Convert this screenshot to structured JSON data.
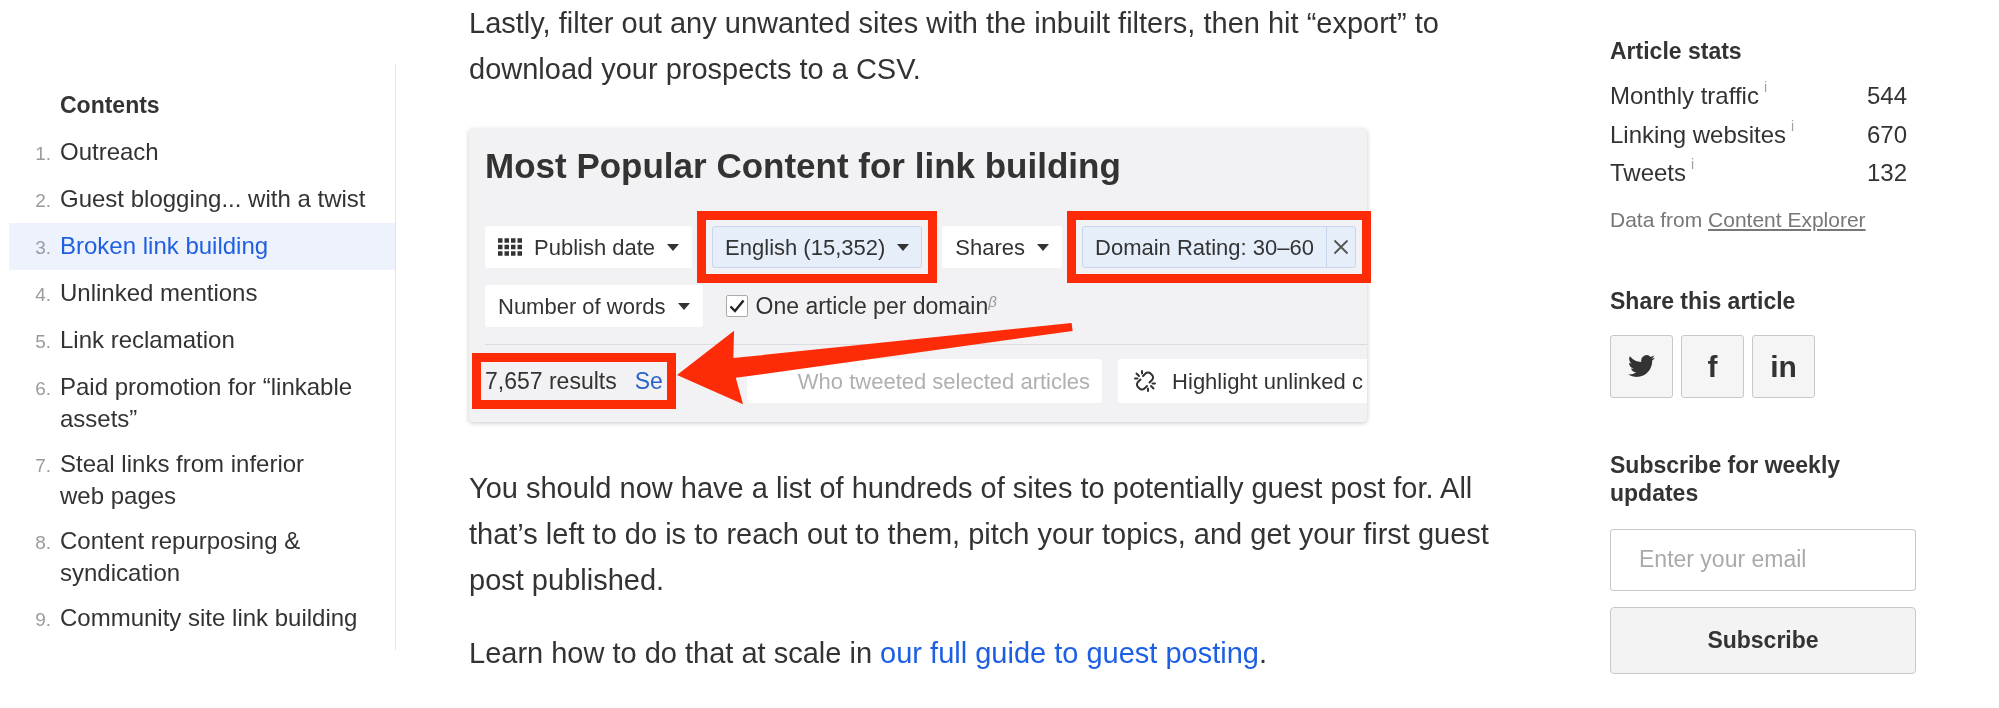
{
  "toc": {
    "heading": "Contents",
    "items": [
      {
        "number": "1.",
        "label": "Outreach",
        "selected": false
      },
      {
        "number": "2.",
        "label": "Guest blogging... with a twist",
        "selected": false
      },
      {
        "number": "3.",
        "label": "Broken link building",
        "selected": true
      },
      {
        "number": "4.",
        "label": "Unlinked mentions",
        "selected": false
      },
      {
        "number": "5.",
        "label": "Link reclamation",
        "selected": false
      },
      {
        "number": "6.",
        "label": "Paid promotion for “linkable assets”",
        "selected": false
      },
      {
        "number": "7.",
        "label": "Steal links from inferior web pages",
        "selected": false
      },
      {
        "number": "8.",
        "label": "Content repurposing & syndication",
        "selected": false
      },
      {
        "number": "9.",
        "label": "Community site link building",
        "selected": false
      }
    ]
  },
  "article": {
    "blocks": [
      {
        "kind": "paragraph",
        "parts": [
          {
            "kind": "text",
            "text": "Lastly, filter out any unwanted sites with the inbuilt filters, then hit “export” to download your prospects to a CSV."
          }
        ]
      },
      {
        "kind": "screenshot",
        "title": "Most Popular Content for link building",
        "filter_rows": [
          [
            {
              "kind": "menu",
              "label": "Publish date",
              "applied": false,
              "highlighted": false
            },
            {
              "kind": "dropdown",
              "label": "English (15,352)",
              "applied": true,
              "highlighted": true
            },
            {
              "kind": "dropdown",
              "label": "Shares",
              "applied": false,
              "highlighted": false
            },
            {
              "kind": "chip",
              "label": "Domain Rating: 30–60",
              "applied": true,
              "highlighted": true
            }
          ],
          [
            {
              "kind": "dropdown",
              "label": "Number of words",
              "applied": false,
              "highlighted": false
            },
            {
              "kind": "checkbox",
              "label": "One article per domain$^{β}$",
              "checked": true
            }
          ]
        ],
        "results": {
          "count": "7,657 results",
          "link": "Se",
          "highlighted": true
        },
        "actions": [
          {
            "kind": "plain",
            "label": "Who tweeted selected articles",
            "disabled": true
          },
          {
            "kind": "unlink",
            "label": "Highlight unlinked c",
            "disabled": false
          }
        ]
      },
      {
        "kind": "paragraph",
        "parts": [
          {
            "kind": "text",
            "text": "You should now have a list of hundreds of sites to potentially guest post for. All that’s left to do is to reach out to them, pitch your topics, and get your first guest post published."
          }
        ]
      },
      {
        "kind": "paragraph",
        "parts": [
          {
            "kind": "text",
            "text": "Learn how to do that at scale in "
          },
          {
            "kind": "link",
            "text": "our full guide to guest posting"
          },
          {
            "kind": "text",
            "text": "."
          }
        ]
      }
    ]
  },
  "sidebar": {
    "stats": {
      "heading": "Article stats",
      "rows": [
        {
          "label": "Monthly traffic",
          "info": "i",
          "value": "544"
        },
        {
          "label": "Linking websites",
          "info": "i",
          "value": "670"
        },
        {
          "label": "Tweets",
          "info": "i",
          "value": "132"
        }
      ],
      "source": {
        "text": "Data from ",
        "link": "Content Explorer"
      }
    },
    "share": {
      "heading": "Share this article",
      "buttons": [
        {
          "kind": "bird"
        },
        {
          "kind": "letter",
          "label": "f"
        },
        {
          "kind": "letter",
          "label": "in"
        }
      ]
    },
    "subscribe": {
      "heading": "Subscribe for weekly updates",
      "email": {
        "placeholder": "Enter your email"
      },
      "button": "Subscribe"
    }
  }
}
